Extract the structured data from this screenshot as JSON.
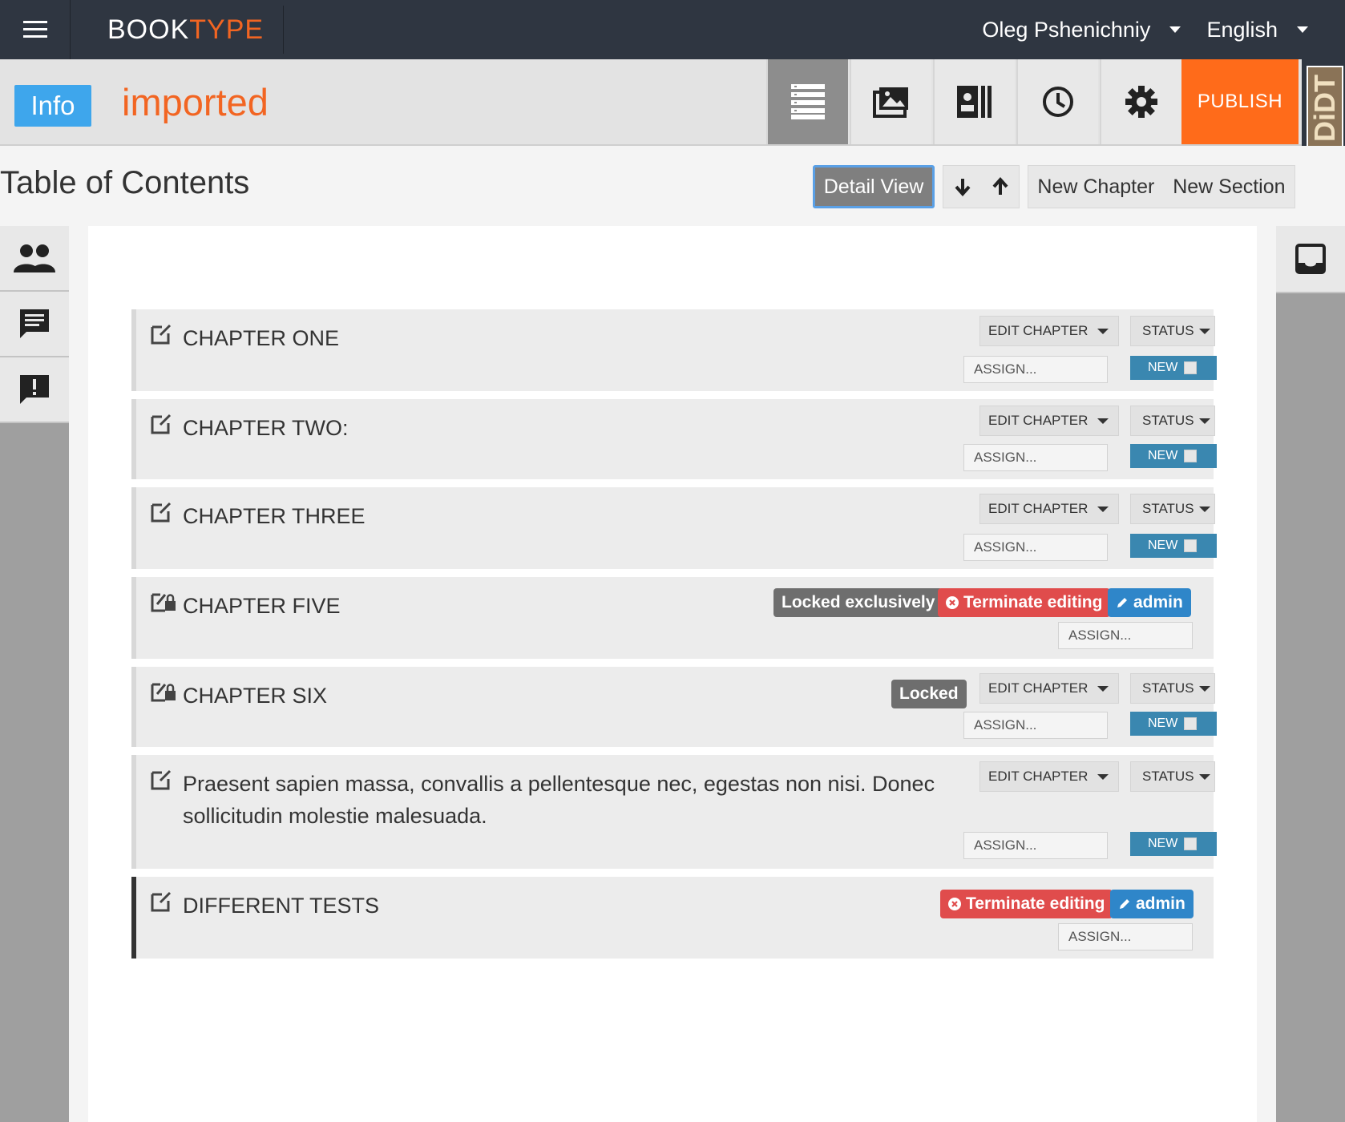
{
  "topbar": {
    "logo_book": "BOOK",
    "logo_type": "TYPE",
    "user": "Oleg Pshenichniy",
    "language": "English"
  },
  "bookbar": {
    "info_label": "Info",
    "book_title": "imported",
    "publish_label": "PUBLISH",
    "plugin_label": "DiDT"
  },
  "toc": {
    "title": "Table of Contents",
    "detail_view": "Detail View",
    "new_chapter": "New Chapter",
    "new_section": "New Section"
  },
  "labels": {
    "edit_chapter": "EDIT CHAPTER",
    "status": "STATUS",
    "assign": "ASSIGN...",
    "new": "NEW",
    "locked_exclusively": "Locked exclusively",
    "locked": "Locked",
    "terminate": "Terminate editing",
    "admin": "admin"
  },
  "chapters": [
    {
      "title": "CHAPTER ONE"
    },
    {
      "title": "CHAPTER TWO:"
    },
    {
      "title": "CHAPTER THREE"
    },
    {
      "title": "CHAPTER FIVE"
    },
    {
      "title": "CHAPTER SIX"
    },
    {
      "title": "Praesent sapien massa, convallis a pellentesque nec, egestas non nisi. Donec sollicitudin molestie malesuada."
    },
    {
      "title": "DIFFERENT TESTS"
    }
  ],
  "colors": {
    "accent_orange": "#f26522",
    "publish_orange": "#ff6b1a",
    "info_blue": "#3ea6ec",
    "new_blue": "#3a87b0",
    "terminate_red": "#e04c4c",
    "admin_blue": "#2f86c9",
    "topbar_dark": "#2f3641"
  }
}
